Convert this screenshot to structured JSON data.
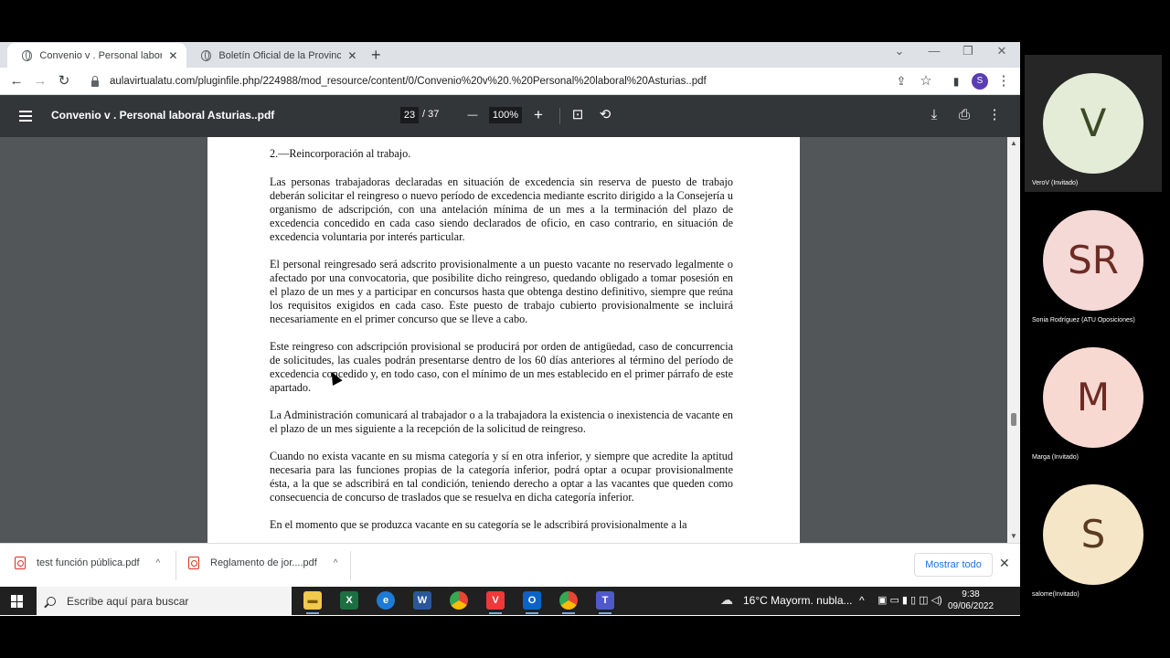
{
  "browser": {
    "tabs": [
      {
        "title": "Convenio v . Personal laboral Ast",
        "active": true
      },
      {
        "title": "Boletín Oficial de la Provincia de",
        "active": false
      }
    ],
    "new_tab": "+",
    "controls": {
      "chevron": "⌄",
      "minimize": "—",
      "restore": "❐",
      "close": "✕"
    },
    "nav": {
      "back": "←",
      "forward": "→",
      "reload": "↻"
    },
    "url": "aulavirtualatu.com/pluginfile.php/224988/mod_resource/content/0/Convenio%20v%20.%20Personal%20laboral%20Asturias..pdf",
    "profile_initial": "S",
    "toolbar_icons": {
      "share": "⇪",
      "star": "☆",
      "sidepanel": "▮",
      "menu": "⋮"
    }
  },
  "pdf": {
    "title": "Convenio v . Personal laboral Asturias..pdf",
    "current_page": "23",
    "total_pages": "/ 37",
    "zoom": "100%",
    "icons": {
      "zoom_out": "—",
      "zoom_in": "+",
      "fit": "⊡",
      "rotate": "⟲",
      "download": "⤓",
      "print": "⎙",
      "more": "⋮"
    },
    "heading": "2.—Reincorporación al trabajo.",
    "paragraphs": [
      "Las personas trabajadoras declaradas en situación de excedencia sin reserva de puesto de trabajo deberán solicitar el reingreso o nuevo período de excedencia mediante escrito dirigido a la Consejería u organismo de adscripción, con una antelación mínima de un mes a la terminación del plazo de excedencia concedido en cada caso siendo declarados de oficio, en caso contrario, en situación de excedencia voluntaria por interés particular.",
      "El personal reingresado será adscrito provisionalmente a un puesto vacante no reservado legalmente o afectado por una convocatoria, que posibilite dicho reingreso, quedando obligado a tomar posesión en el plazo de un mes y a participar en concursos hasta que obtenga destino definitivo, siempre que reúna los requisitos exigidos en cada caso. Este puesto de trabajo cubierto provisionalmente se incluirá necesariamente en el primer concurso que se lleve a cabo.",
      "Este reingreso con adscripción provisional se producirá por orden de antigüedad, caso de concurrencia de solicitudes, las cuales podrán presentarse dentro de los 60 días anteriores al término del período de excedencia concedido y, en todo caso, con el mínimo de un mes establecido en el primer párrafo de este apartado.",
      "La Administración comunicará al trabajador o a la trabajadora la existencia o inexistencia de vacante en el plazo de un mes siguiente a la recepción de la solicitud de reingreso.",
      "Cuando no exista vacante en su misma categoría y sí en otra inferior, y siempre que acredite la aptitud necesaria para las funciones propias de la categoría inferior, podrá optar a ocupar provisionalmente ésta, a la que se adscribirá en tal condición, teniendo derecho a optar a las vacantes que queden como consecuencia de concurso de traslados que se resuelva en dicha categoría inferior.",
      "En el momento que se produzca vacante en su categoría se le adscribirá provisionalmente a la"
    ]
  },
  "downloads": {
    "items": [
      "test función pública.pdf",
      "Reglamento de jor....pdf"
    ],
    "show_all": "Mostrar todo",
    "close": "✕",
    "caret": "^"
  },
  "taskbar": {
    "search_placeholder": "Escribe aquí para buscar",
    "apps": [
      "file-explorer",
      "excel",
      "edge",
      "word",
      "chrome",
      "vivaldi",
      "outlook",
      "chrome-profile",
      "teams"
    ],
    "weather": "16°C  Mayorm. nubla...",
    "time": "9:38",
    "date": "09/06/2022"
  },
  "participants": [
    {
      "initials": "V",
      "name": "VeroV (Invitado)",
      "color": "#e4ecd8",
      "text_color": "#3b4a22",
      "speaking": true
    },
    {
      "initials": "SR",
      "name": "Sonia Rodríguez (ATU Oposiciones)",
      "color": "#f4d9d6",
      "text_color": "#6e2b24",
      "speaking": false
    },
    {
      "initials": "M",
      "name": "Marga (Invitado)",
      "color": "#f7d9d2",
      "text_color": "#6e2b24",
      "speaking": false
    },
    {
      "initials": "S",
      "name": "salome(Invitado)",
      "color": "#f6e6c8",
      "text_color": "#5a3b22",
      "speaking": false
    }
  ]
}
